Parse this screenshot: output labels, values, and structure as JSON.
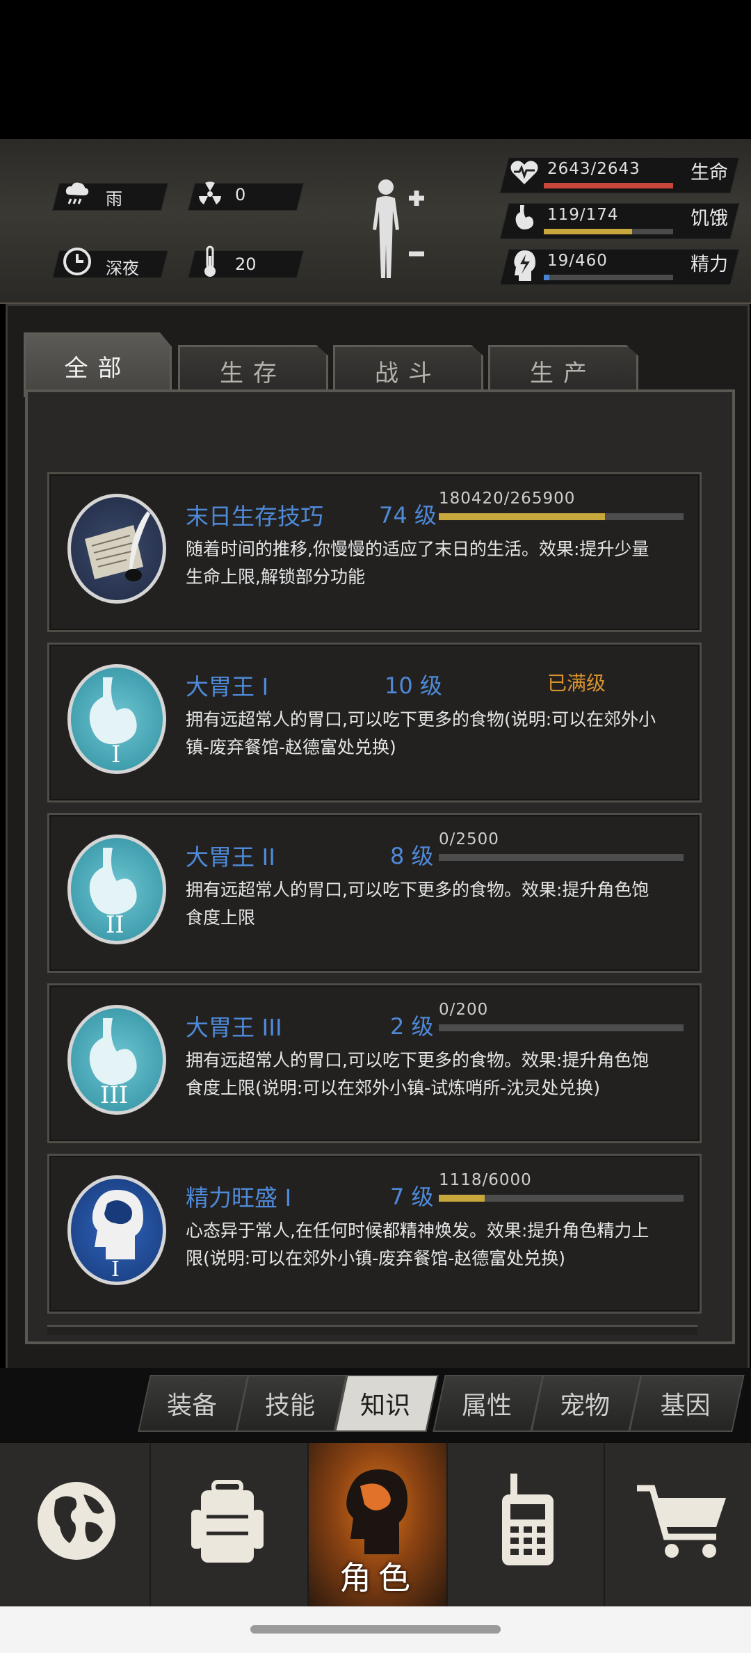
{
  "status": {
    "weather": {
      "icon": "rain-cloud-icon",
      "label": "雨"
    },
    "radiation": {
      "icon": "radiation-icon",
      "value": "0"
    },
    "time_of_day": {
      "icon": "clock-icon",
      "label": "深夜"
    },
    "temperature": {
      "icon": "thermometer-icon",
      "value": "20"
    }
  },
  "stats": [
    {
      "name": "health",
      "label": "生命",
      "text": "2643/2643",
      "fraction": 1.0,
      "color": "#c9463a",
      "icon": "heart-pulse-icon"
    },
    {
      "name": "hunger",
      "label": "饥饿",
      "text": "119/174",
      "fraction": 0.684,
      "color": "#c8a73c",
      "icon": "stomach-icon"
    },
    {
      "name": "energy",
      "label": "精力",
      "text": "19/460",
      "fraction": 0.041,
      "color": "#4a83d3",
      "icon": "energy-head-icon"
    }
  ],
  "category_tabs": [
    {
      "label": "全部",
      "active": true
    },
    {
      "label": "生存",
      "active": false
    },
    {
      "label": "战斗",
      "active": false
    },
    {
      "label": "生产",
      "active": false
    }
  ],
  "skills": [
    {
      "name": "末日生存技巧",
      "level": "74 级",
      "progress_text": "180420/265900",
      "fraction": 0.6785,
      "maxed": false,
      "max_label": "",
      "desc": "随着时间的推移,你慢慢的适应了末日的生活。效果:提升少量生命上限,解锁部分功能",
      "icon": "scroll-quill-icon"
    },
    {
      "name": "大胃王 I",
      "level": "10 级",
      "progress_text": "",
      "fraction": 1.0,
      "maxed": true,
      "max_label": "已满级",
      "desc": "拥有远超常人的胃口,可以吃下更多的食物(说明:可以在郊外小镇-废弃餐馆-赵德富处兑换)",
      "icon": "stomach-icon"
    },
    {
      "name": "大胃王 II",
      "level": "8 级",
      "progress_text": "0/2500",
      "fraction": 0.0,
      "maxed": false,
      "max_label": "",
      "desc": "拥有远超常人的胃口,可以吃下更多的食物。效果:提升角色饱食度上限",
      "icon": "stomach-icon"
    },
    {
      "name": "大胃王 III",
      "level": "2 级",
      "progress_text": "0/200",
      "fraction": 0.0,
      "maxed": false,
      "max_label": "",
      "desc": "拥有远超常人的胃口,可以吃下更多的食物。效果:提升角色饱食度上限(说明:可以在郊外小镇-试炼哨所-沈灵处兑换)",
      "icon": "stomach-icon"
    },
    {
      "name": "精力旺盛 I",
      "level": "7 级",
      "progress_text": "1118/6000",
      "fraction": 0.1863,
      "maxed": false,
      "max_label": "",
      "desc": "心态异于常人,在任何时候都精神焕发。效果:提升角色精力上限(说明:可以在郊外小镇-废弃餐馆-赵德富处兑换)",
      "icon": "brain-head-icon"
    }
  ],
  "sub_tabs": [
    {
      "label": "装备",
      "active": false
    },
    {
      "label": "技能",
      "active": false
    },
    {
      "label": "知识",
      "active": true
    },
    {
      "label": "属性",
      "active": false
    },
    {
      "label": "宠物",
      "active": false
    },
    {
      "label": "基因",
      "active": false
    }
  ],
  "bottom_nav": [
    {
      "icon": "globe-icon",
      "label": "",
      "active": false
    },
    {
      "icon": "backpack-icon",
      "label": "",
      "active": false
    },
    {
      "icon": "character-head-icon",
      "label": "角色",
      "active": true
    },
    {
      "icon": "walkie-talkie-icon",
      "label": "",
      "active": false
    },
    {
      "icon": "shopping-cart-icon",
      "label": "",
      "active": false
    }
  ]
}
